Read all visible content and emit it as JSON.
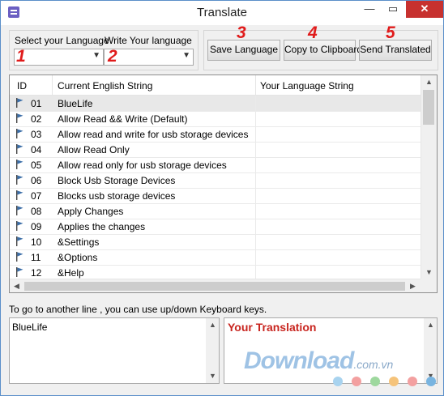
{
  "window": {
    "title": "Translate",
    "buttons": {
      "minimize": "—",
      "maximize": "▭",
      "close": "✕"
    }
  },
  "language_panel": {
    "select_label": "Select your Language",
    "write_label": "Write Your language",
    "select_value": "",
    "write_value": ""
  },
  "annotations": [
    "1",
    "2",
    "3",
    "4",
    "5"
  ],
  "toolbar": {
    "save_label": "Save Language",
    "copy_label": "Copy to Clipboard",
    "send_label": "Send Translated"
  },
  "table": {
    "columns": [
      "ID",
      "Current English String",
      "Your Language String"
    ],
    "rows": [
      {
        "id": "01",
        "english": "BlueLife",
        "translation": ""
      },
      {
        "id": "02",
        "english": "Allow Read && Write (Default)",
        "translation": ""
      },
      {
        "id": "03",
        "english": "Allow read and write for usb storage devices",
        "translation": ""
      },
      {
        "id": "04",
        "english": "Allow Read Only",
        "translation": ""
      },
      {
        "id": "05",
        "english": "Allow read only for usb storage devices",
        "translation": ""
      },
      {
        "id": "06",
        "english": "Block Usb Storage Devices",
        "translation": ""
      },
      {
        "id": "07",
        "english": "Blocks usb storage devices",
        "translation": ""
      },
      {
        "id": "08",
        "english": "Apply Changes",
        "translation": ""
      },
      {
        "id": "09",
        "english": "Applies the changes",
        "translation": ""
      },
      {
        "id": "10",
        "english": "&Settings",
        "translation": ""
      },
      {
        "id": "11",
        "english": "&Options",
        "translation": ""
      },
      {
        "id": "12",
        "english": "&Help",
        "translation": ""
      }
    ],
    "selected_row": "01"
  },
  "hint": "To go to another line , you can use up/down Keyboard keys.",
  "source_box": {
    "value": "BlueLife"
  },
  "translation_box": {
    "title": "Your Translation",
    "value": ""
  },
  "watermark": {
    "text": "Download",
    "domain": ".com.vn"
  },
  "colors": {
    "annotation": "#e01b1b",
    "close_button": "#c7312f",
    "translation_title": "#c8251f",
    "watermark": "#9fc3e5",
    "flag": "#3d6fa8",
    "dots": [
      "#a8d3ef",
      "#f3a0a0",
      "#9ed89e",
      "#f5c37a",
      "#f3a0a0",
      "#78b4e0"
    ]
  },
  "icons": {
    "app": "app-icon",
    "flag": "flag-icon"
  }
}
